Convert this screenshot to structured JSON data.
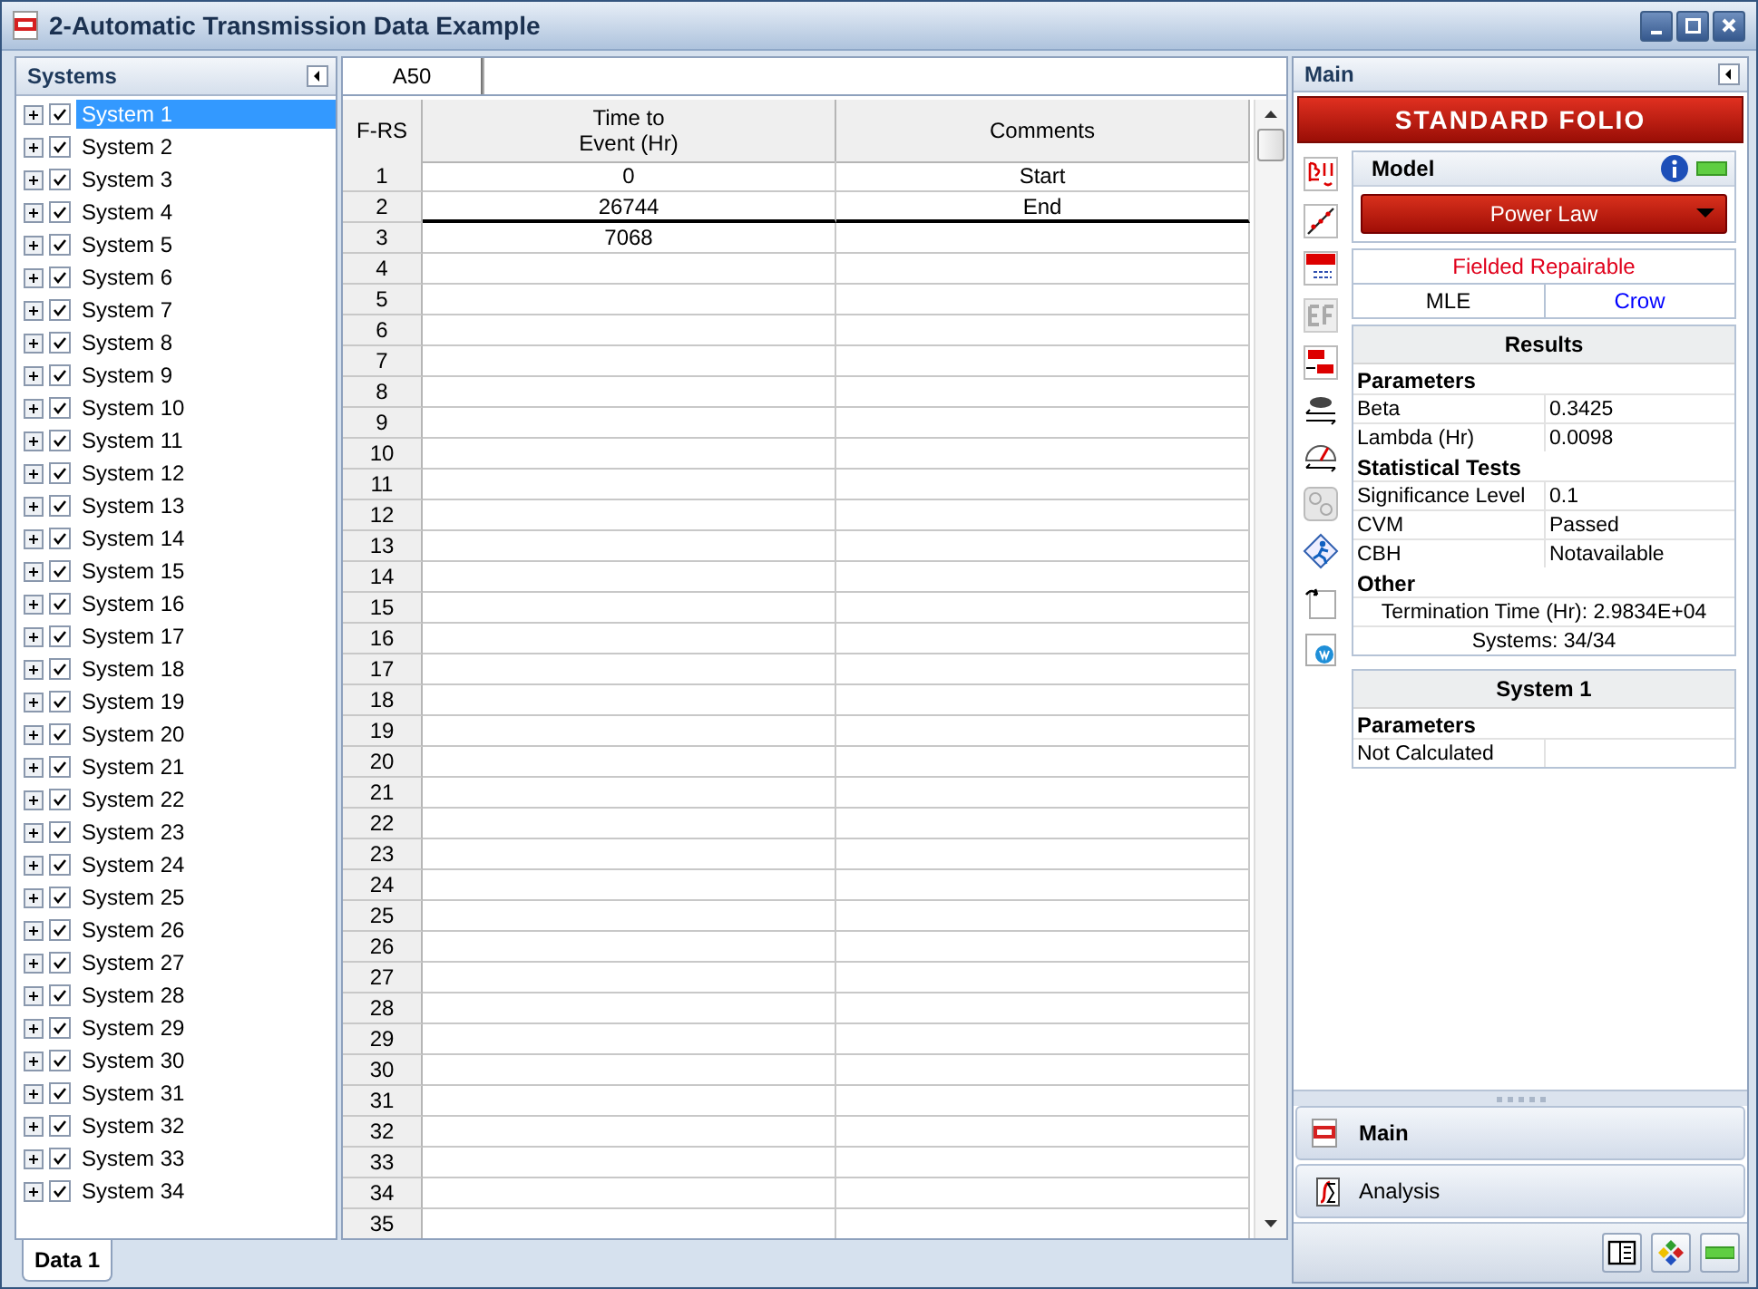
{
  "window": {
    "title": "2-Automatic Transmission Data Example"
  },
  "systems_panel": {
    "title": "Systems",
    "items": [
      {
        "label": "System 1",
        "checked": true,
        "selected": true
      },
      {
        "label": "System 2",
        "checked": true,
        "selected": false
      },
      {
        "label": "System 3",
        "checked": true,
        "selected": false
      },
      {
        "label": "System 4",
        "checked": true,
        "selected": false
      },
      {
        "label": "System 5",
        "checked": true,
        "selected": false
      },
      {
        "label": "System 6",
        "checked": true,
        "selected": false
      },
      {
        "label": "System 7",
        "checked": true,
        "selected": false
      },
      {
        "label": "System 8",
        "checked": true,
        "selected": false
      },
      {
        "label": "System 9",
        "checked": true,
        "selected": false
      },
      {
        "label": "System 10",
        "checked": true,
        "selected": false
      },
      {
        "label": "System 11",
        "checked": true,
        "selected": false
      },
      {
        "label": "System 12",
        "checked": true,
        "selected": false
      },
      {
        "label": "System 13",
        "checked": true,
        "selected": false
      },
      {
        "label": "System 14",
        "checked": true,
        "selected": false
      },
      {
        "label": "System 15",
        "checked": true,
        "selected": false
      },
      {
        "label": "System 16",
        "checked": true,
        "selected": false
      },
      {
        "label": "System 17",
        "checked": true,
        "selected": false
      },
      {
        "label": "System 18",
        "checked": true,
        "selected": false
      },
      {
        "label": "System 19",
        "checked": true,
        "selected": false
      },
      {
        "label": "System 20",
        "checked": true,
        "selected": false
      },
      {
        "label": "System 21",
        "checked": true,
        "selected": false
      },
      {
        "label": "System 22",
        "checked": true,
        "selected": false
      },
      {
        "label": "System 23",
        "checked": true,
        "selected": false
      },
      {
        "label": "System 24",
        "checked": true,
        "selected": false
      },
      {
        "label": "System 25",
        "checked": true,
        "selected": false
      },
      {
        "label": "System 26",
        "checked": true,
        "selected": false
      },
      {
        "label": "System 27",
        "checked": true,
        "selected": false
      },
      {
        "label": "System 28",
        "checked": true,
        "selected": false
      },
      {
        "label": "System 29",
        "checked": true,
        "selected": false
      },
      {
        "label": "System 30",
        "checked": true,
        "selected": false
      },
      {
        "label": "System 31",
        "checked": true,
        "selected": false
      },
      {
        "label": "System 32",
        "checked": true,
        "selected": false
      },
      {
        "label": "System 33",
        "checked": true,
        "selected": false
      },
      {
        "label": "System 34",
        "checked": true,
        "selected": false
      }
    ]
  },
  "sheet": {
    "cell_ref": "A50",
    "columns": [
      "F-RS",
      "Time to Event (Hr)",
      "Comments"
    ],
    "rows": [
      {
        "number": "1",
        "time": "0",
        "comment": "Start",
        "separator_below": false
      },
      {
        "number": "2",
        "time": "26744",
        "comment": "End",
        "separator_below": true
      },
      {
        "number": "3",
        "time": "7068",
        "separator_below": false
      },
      {
        "number": "4",
        "separator_below": false
      },
      {
        "number": "5",
        "separator_below": false
      },
      {
        "number": "6",
        "separator_below": false
      },
      {
        "number": "7",
        "separator_below": false
      },
      {
        "number": "8",
        "separator_below": false
      },
      {
        "number": "9",
        "separator_below": false
      },
      {
        "number": "10",
        "separator_below": false
      },
      {
        "number": "11",
        "separator_below": false
      },
      {
        "number": "12",
        "separator_below": false
      },
      {
        "number": "13",
        "separator_below": false
      },
      {
        "number": "14",
        "separator_below": false
      },
      {
        "number": "15",
        "separator_below": false
      },
      {
        "number": "16",
        "separator_below": false
      },
      {
        "number": "17",
        "separator_below": false
      },
      {
        "number": "18",
        "separator_below": false
      },
      {
        "number": "19",
        "separator_below": false
      },
      {
        "number": "20",
        "separator_below": false
      },
      {
        "number": "21",
        "separator_below": false
      },
      {
        "number": "22",
        "separator_below": false
      },
      {
        "number": "23",
        "separator_below": false
      },
      {
        "number": "24",
        "separator_below": false
      },
      {
        "number": "25",
        "separator_below": false
      },
      {
        "number": "26",
        "separator_below": false
      },
      {
        "number": "27",
        "separator_below": false
      },
      {
        "number": "28",
        "separator_below": false
      },
      {
        "number": "29",
        "separator_below": false
      },
      {
        "number": "30",
        "separator_below": false
      },
      {
        "number": "31",
        "separator_below": false
      },
      {
        "number": "32",
        "separator_below": false
      },
      {
        "number": "33",
        "separator_below": false
      },
      {
        "number": "34",
        "separator_below": false
      },
      {
        "number": "35",
        "separator_below": false
      }
    ]
  },
  "sheet_tabs": [
    {
      "label": "Data 1",
      "selected": true
    }
  ],
  "folio_panel": {
    "title": "Main",
    "banner": "STANDARD FOLIO",
    "model": {
      "title": "Model",
      "value": "Power Law"
    },
    "data_type": "Fielded Repairable",
    "methods": [
      {
        "label": "MLE",
        "color": "#000000"
      },
      {
        "label": "Crow",
        "color": "#0000ff"
      }
    ],
    "results": {
      "title": "Results",
      "sections": [
        {
          "kind": "table",
          "heading": "Parameters",
          "rows": [
            {
              "label": "Beta",
              "value": "0.3425"
            },
            {
              "label": "Lambda (Hr)",
              "value": "0.0098"
            }
          ]
        },
        {
          "kind": "table",
          "heading": "Statistical Tests",
          "rows": [
            {
              "label": "Significance Level",
              "value": "0.1"
            },
            {
              "label": "CVM",
              "value": "Passed"
            },
            {
              "label": "CBH",
              "value": "Notavailable"
            }
          ]
        },
        {
          "kind": "lines",
          "heading": "Other",
          "lines": [
            "Termination Time (Hr): 2.9834E+04",
            "Systems: 34/34"
          ]
        }
      ]
    },
    "system": {
      "title": "System 1",
      "sections": [
        {
          "kind": "table",
          "heading": "Parameters",
          "rows": [
            {
              "label": "Not Calculated"
            }
          ]
        }
      ]
    },
    "nav": [
      {
        "label": "Main",
        "selected": true
      },
      {
        "label": "Analysis",
        "selected": false
      }
    ]
  }
}
